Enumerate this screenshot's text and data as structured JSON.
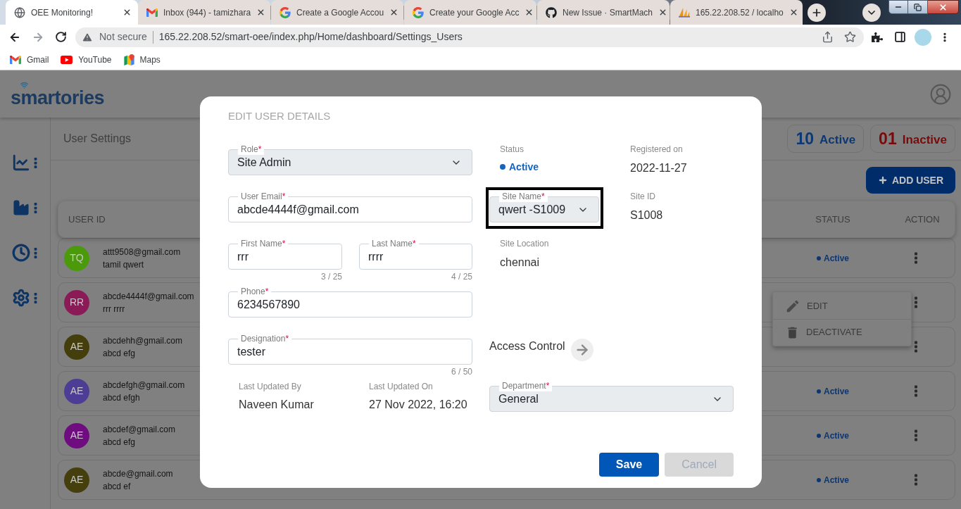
{
  "browser": {
    "tabs": [
      {
        "title": "OEE Monitoring!",
        "selected": true
      },
      {
        "title": "Inbox (944) - tamizhara",
        "selected": false
      },
      {
        "title": "Create a Google Accou",
        "selected": false
      },
      {
        "title": "Create your Google Acc",
        "selected": false
      },
      {
        "title": "New Issue · SmartMach",
        "selected": false
      },
      {
        "title": "165.22.208.52 / localho",
        "selected": false
      }
    ],
    "address_bar": {
      "security_label": "Not secure",
      "url": "165.22.208.52/smart-oee/index.php/Home/dashboard/Settings_Users"
    },
    "bookmarks": [
      {
        "label": "Gmail"
      },
      {
        "label": "YouTube"
      },
      {
        "label": "Maps"
      }
    ]
  },
  "app": {
    "logo": "smartories",
    "page_title": "User Settings",
    "stats": [
      {
        "count": "10",
        "label": "Active",
        "color": "#0c3874"
      },
      {
        "count": "01",
        "label": "Inactive",
        "color": "#7a0a0a"
      }
    ],
    "add_button": "ADD USER",
    "table": {
      "columns": [
        "USER ID",
        "STATUS",
        "ACTION"
      ],
      "rows": [
        {
          "initials": "TQ",
          "color": "#4a9a0c",
          "email": "attt9508@gmail.com",
          "name": "tamil qwert",
          "status": "Active"
        },
        {
          "initials": "RR",
          "color": "#8a1b57",
          "email": "abcde4444f@gmail.com",
          "name": "rrr rrrr"
        },
        {
          "initials": "AE",
          "color": "#443e0c",
          "email": "abcdehh@gmail.com",
          "name": "abcd efg"
        },
        {
          "initials": "AE",
          "color": "#4e3d94",
          "email": "abcdefgh@gmail.com",
          "name": "abcd efgh",
          "status": "Active"
        },
        {
          "initials": "AE",
          "color": "#6f0c7f",
          "email": "abcdef@gmail.com",
          "name": "abcd efg",
          "status": "Active"
        },
        {
          "initials": "AE",
          "color": "#453f0d",
          "email": "abcde@gmail.com",
          "name": "abcd ef",
          "status": "Active"
        }
      ]
    },
    "row_menu": [
      {
        "label": "EDIT"
      },
      {
        "label": "DEACTIVATE"
      }
    ]
  },
  "dialog": {
    "title": "EDIT USER DETAILS",
    "role": {
      "label": "Role",
      "mark": "*",
      "value": "Site Admin"
    },
    "email": {
      "label": "User Email",
      "mark": "*",
      "value": "abcde4444f@gmail.com"
    },
    "first_name": {
      "label": "First Name",
      "mark": "*",
      "value": "rrr",
      "counter": "3 / 25"
    },
    "last_name": {
      "label": "Last Name",
      "mark": "*",
      "value": "rrrr",
      "counter": "4 / 25"
    },
    "phone": {
      "label": "Phone",
      "mark": "*",
      "value": "6234567890"
    },
    "designation": {
      "label": "Designation",
      "mark": "*",
      "value": "tester",
      "counter": "6 / 50"
    },
    "last_updated_by": {
      "label": "Last Updated By",
      "value": "Naveen Kumar"
    },
    "last_updated_on": {
      "label": "Last Updated On",
      "value": "27 Nov 2022, 16:20"
    },
    "status": {
      "label": "Status",
      "value": "Active"
    },
    "registered_on": {
      "label": "Registered on",
      "value": "2022-11-27"
    },
    "site_name": {
      "label": "Site Name",
      "mark": "*",
      "value": "qwert -S1009",
      "highlighted": true
    },
    "site_id": {
      "label": "Site ID",
      "value": "S1008"
    },
    "site_location": {
      "label": "Site Location",
      "value": "chennai"
    },
    "access_control": {
      "label": "Access Control"
    },
    "department": {
      "label": "Department",
      "mark": "*",
      "value": "General"
    },
    "buttons": [
      {
        "label": "Save",
        "disabled": false
      },
      {
        "label": "Cancel",
        "disabled": true
      }
    ]
  }
}
